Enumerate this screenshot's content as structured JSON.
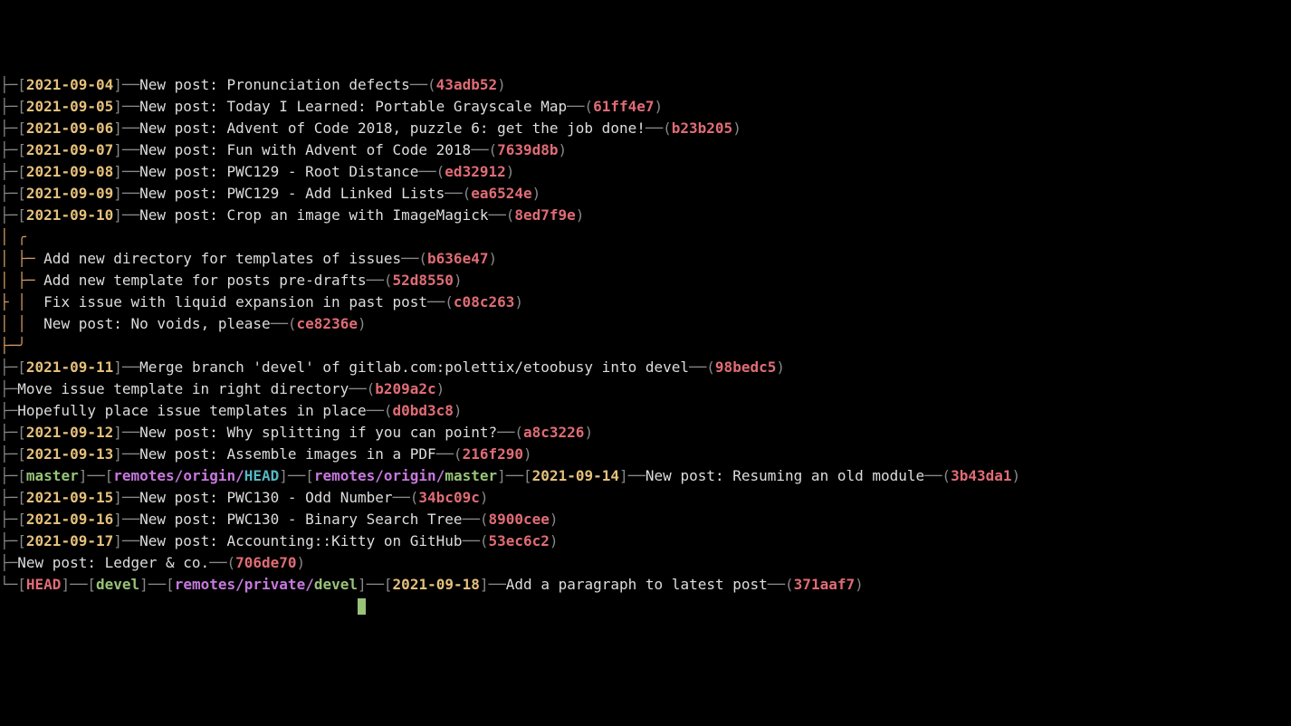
{
  "graph": {
    "pipe": "│",
    "branch": "├─",
    "last": "└─",
    "b_open": "[",
    "b_close": "]",
    "p_open": "(",
    "p_close": ")",
    "dashdash": "──",
    "dash": "─",
    "pipe_branch": "│ ├─",
    "pipe_last": "│ └─",
    "corner_top": "│ ╭",
    "corner_bot": "├─╯"
  },
  "lines": [
    {
      "indent": "├─",
      "refs": [
        {
          "txt": "2021-09-04",
          "cls": "yellow"
        }
      ],
      "msg": "New post: Pronunciation defects",
      "hash": "43adb52",
      "top": true
    },
    {
      "indent": "├─",
      "refs": [
        {
          "txt": "2021-09-05",
          "cls": "yellow"
        }
      ],
      "msg": "New post: Today I Learned: Portable Grayscale Map",
      "hash": "61ff4e7"
    },
    {
      "indent": "├─",
      "refs": [
        {
          "txt": "2021-09-06",
          "cls": "yellow"
        }
      ],
      "msg": "New post: Advent of Code 2018, puzzle 6: get the job done!",
      "hash": "b23b205"
    },
    {
      "indent": "├─",
      "refs": [
        {
          "txt": "2021-09-07",
          "cls": "yellow"
        }
      ],
      "msg": "New post: Fun with Advent of Code 2018",
      "hash": "7639d8b"
    },
    {
      "indent": "├─",
      "refs": [
        {
          "txt": "2021-09-08",
          "cls": "yellow"
        }
      ],
      "msg": "New post: PWC129 - Root Distance",
      "hash": "ed32912"
    },
    {
      "indent": "├─",
      "refs": [
        {
          "txt": "2021-09-09",
          "cls": "yellow"
        }
      ],
      "msg": "New post: PWC129 - Add Linked Lists",
      "hash": "ea6524e"
    },
    {
      "indent": "├─",
      "refs": [
        {
          "txt": "2021-09-10",
          "cls": "yellow"
        }
      ],
      "msg": "New post: Crop an image with ImageMagick",
      "hash": "8ed7f9e"
    },
    {
      "kind": "box_top"
    },
    {
      "indent": "│ ├─ ",
      "msg": "Add new directory for templates of issues",
      "hash": "b636e47",
      "box": true
    },
    {
      "indent": "│ ├─ ",
      "msg": "Add new template for posts pre-drafts",
      "hash": "52d8550",
      "box": true
    },
    {
      "indent": "├ │  ",
      "msg": "Fix issue with liquid expansion in past post",
      "hash": "c08c263",
      "box": true
    },
    {
      "indent": "│ │  ",
      "msg": "New post: No voids, please",
      "hash": "ce8236e",
      "box": true
    },
    {
      "kind": "box_bot"
    },
    {
      "indent": "├─",
      "refs": [
        {
          "txt": "2021-09-11",
          "cls": "yellow"
        }
      ],
      "msg": "Merge branch 'devel' of gitlab.com:polettix/etoobusy into devel",
      "hash": "98bedc5"
    },
    {
      "indent": "├─",
      "msg": "Move issue template in right directory",
      "hash": "b209a2c"
    },
    {
      "indent": "├─",
      "msg": "Hopefully place issue templates in place",
      "hash": "d0bd3c8"
    },
    {
      "indent": "├─",
      "refs": [
        {
          "txt": "2021-09-12",
          "cls": "yellow"
        }
      ],
      "msg": "New post: Why splitting if you can point?",
      "hash": "a8c3226"
    },
    {
      "indent": "├─",
      "refs": [
        {
          "txt": "2021-09-13",
          "cls": "yellow"
        }
      ],
      "msg": "New post: Assemble images in a PDF",
      "hash": "216f290"
    },
    {
      "indent": "├─",
      "refs": [
        {
          "txt": "master",
          "cls": "green"
        },
        {
          "seg": [
            {
              "txt": "remotes/origin/",
              "cls": "magenta"
            },
            {
              "txt": "HEAD",
              "cls": "cyan"
            }
          ]
        },
        {
          "seg": [
            {
              "txt": "remotes/origin/",
              "cls": "magenta"
            },
            {
              "txt": "master",
              "cls": "green"
            }
          ]
        },
        {
          "txt": "2021-09-14",
          "cls": "yellow"
        }
      ],
      "msg": "New post: Resuming an old module",
      "hash": "3b43da1"
    },
    {
      "indent": "├─",
      "refs": [
        {
          "txt": "2021-09-15",
          "cls": "yellow"
        }
      ],
      "msg": "New post: PWC130 - Odd Number",
      "hash": "34bc09c"
    },
    {
      "indent": "├─",
      "refs": [
        {
          "txt": "2021-09-16",
          "cls": "yellow"
        }
      ],
      "msg": "New post: PWC130 - Binary Search Tree",
      "hash": "8900cee"
    },
    {
      "indent": "├─",
      "refs": [
        {
          "txt": "2021-09-17",
          "cls": "yellow"
        }
      ],
      "msg": "New post: Accounting::Kitty on GitHub",
      "hash": "53ec6c2"
    },
    {
      "indent": "├─",
      "msg": "New post: Ledger & co.",
      "hash": "706de70"
    },
    {
      "indent": "└─",
      "refs": [
        {
          "txt": "HEAD",
          "cls": "red"
        },
        {
          "txt": "devel",
          "cls": "green"
        },
        {
          "seg": [
            {
              "txt": "remotes/private/",
              "cls": "magenta"
            },
            {
              "txt": "devel",
              "cls": "green"
            }
          ]
        },
        {
          "txt": "2021-09-18",
          "cls": "yellow"
        }
      ],
      "msg": "Add a paragraph to latest post",
      "hash": "371aaf7"
    }
  ]
}
